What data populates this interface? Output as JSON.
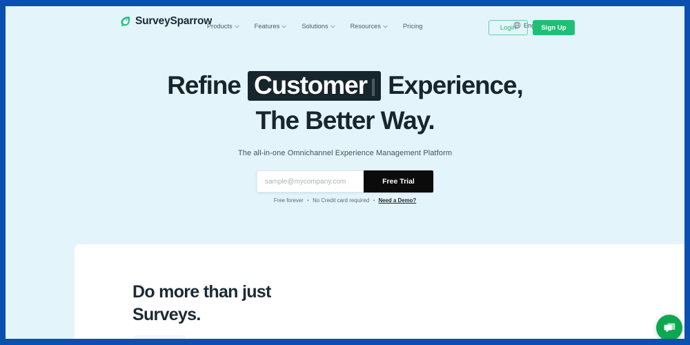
{
  "theme": {
    "frame_border": "#0B4FB0",
    "page_bg": "#E4F4FB",
    "brand_green": "#20BF76",
    "chat_green": "#0DA750",
    "ink": "#17252C",
    "cta_black": "#0B0B0B"
  },
  "navbar": {
    "logo": {
      "icon": "sparrow-leaf-logo-icon",
      "text": "SurveySparrow"
    },
    "menu": [
      {
        "label": "Products",
        "has_dropdown": true,
        "icon": "chevron-down-icon"
      },
      {
        "label": "Features",
        "has_dropdown": true,
        "icon": "chevron-down-icon"
      },
      {
        "label": "Solutions",
        "has_dropdown": true,
        "icon": "chevron-down-icon"
      },
      {
        "label": "Resources",
        "has_dropdown": true,
        "icon": "chevron-down-icon"
      },
      {
        "label": "Pricing",
        "has_dropdown": false,
        "icon": ""
      }
    ],
    "language": {
      "icon": "globe-icon",
      "label": "English",
      "chevron": "chevron-down-icon"
    },
    "login_label": "Login",
    "signup_label": "Sign Up"
  },
  "hero": {
    "heading_part1": "Refine",
    "heading_highlight": "Customer",
    "heading_part2": "Experience,",
    "heading_line2": "The Better Way.",
    "subtitle": "The all-in-one Omnichannel Experience Management Platform",
    "email_placeholder": "sample@mycompany.com",
    "email_value": "",
    "cta_label": "Free Trial",
    "meta_free": "Free forever",
    "meta_sep1": "•",
    "meta_nocard": "No Credit card required",
    "meta_sep2": "•",
    "meta_demo": "Need a Demo?"
  },
  "section": {
    "heading_line1": "Do more than just",
    "heading_line2": "Surveys."
  },
  "chat": {
    "icon": "chat-bubbles-icon",
    "aria_label": "Open chat"
  }
}
